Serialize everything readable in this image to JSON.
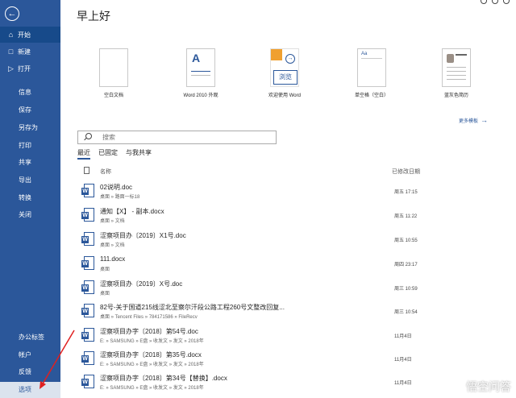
{
  "sidebar": {
    "back_icon": "back-arrow-icon",
    "items": [
      {
        "label": "开始",
        "icon": "home-icon",
        "active": true
      },
      {
        "label": "新建",
        "icon": "new-document-icon"
      },
      {
        "label": "打开",
        "icon": "open-folder-icon"
      },
      {
        "label": "信息"
      },
      {
        "label": "保存"
      },
      {
        "label": "另存为"
      },
      {
        "label": "打印"
      },
      {
        "label": "共享"
      },
      {
        "label": "导出"
      },
      {
        "label": "转换"
      },
      {
        "label": "关闭"
      }
    ],
    "bottom_items": [
      {
        "label": "办公标签"
      },
      {
        "label": "帐户"
      },
      {
        "label": "反馈"
      },
      {
        "label": "选项",
        "highlighted": true
      }
    ],
    "colors": {
      "background": "#2b579a",
      "active": "#174a8a"
    }
  },
  "header": {
    "greeting": "早上好"
  },
  "templates": [
    {
      "label": "空白文档"
    },
    {
      "label": "Word 2010 外观"
    },
    {
      "label": "欢迎使用 Word",
      "thumb_text": "浏览"
    },
    {
      "label": "单空格（空白）"
    },
    {
      "label": "蓝灰色简历"
    }
  ],
  "more_templates": "更多模板",
  "search": {
    "placeholder": "搜索"
  },
  "tabs": [
    {
      "label": "最近",
      "active": true
    },
    {
      "label": "已固定"
    },
    {
      "label": "与我共享"
    }
  ],
  "list": {
    "header_name": "名称",
    "header_date": "已修改日期",
    "rows": [
      {
        "title": "02说明.doc",
        "path": "桌面 » 路面一标18",
        "date": "周五 17:15"
      },
      {
        "title": "通知【X】 - 副本.docx",
        "path": "桌面 » 文档",
        "date": "周五 11:22"
      },
      {
        "title": "涩察项目办〔2019〕X1号.doc",
        "path": "桌面 » 文档",
        "date": "周五 10:55"
      },
      {
        "title": "111.docx",
        "path": "桌面",
        "date": "周四 23:17"
      },
      {
        "title": "涩察项目办〔2019〕X号.doc",
        "path": "桌面",
        "date": "周三 10:59"
      },
      {
        "title": "82号-关于国道215线涩北至察尔汗段公路工程260号文整改回复...",
        "path": "桌面 » Tencent Files » 784171586 » FileRecv",
        "date": "周三 10:54"
      },
      {
        "title": "涩察项目办字〔2018〕第54号.doc",
        "path": "E: » SAMSUNG » E盘 » 收发文 » 发文 » 2018年",
        "date": "11月4日"
      },
      {
        "title": "涩察项目办字〔2018〕第35号.docx",
        "path": "E: » SAMSUNG » E盘 » 收发文 » 发文 » 2018年",
        "date": "11月4日"
      },
      {
        "title": "涩察项目办字〔2018〕第34号【替换】.docx",
        "path": "E: » SAMSUNG » E盘 » 收发文 » 发文 » 2018年",
        "date": "11月4日"
      }
    ]
  },
  "watermark": {
    "text": "悟空问答"
  },
  "annotation": {
    "color": "#e02020"
  }
}
